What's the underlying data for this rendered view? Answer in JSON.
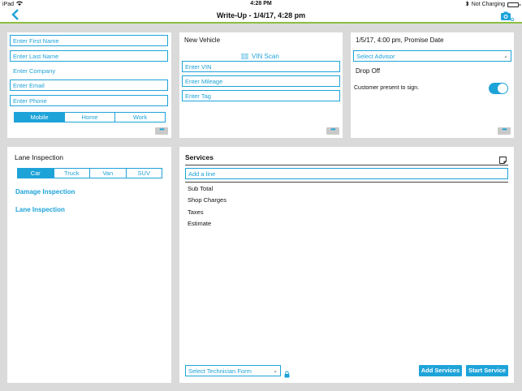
{
  "status_bar": {
    "device": "iPad",
    "time": "4:28 PM",
    "charging": "Not Charging"
  },
  "nav": {
    "title": "Write-Up - 1/4/17, 4:28 pm"
  },
  "customer": {
    "first_name_placeholder": "Enter First Name",
    "last_name_placeholder": "Enter Last Name",
    "company_placeholder": "Enter Company",
    "email_placeholder": "Enter Email",
    "phone_placeholder": "Enter Phone",
    "phone_types": [
      "Mobile",
      "Home",
      "Work"
    ],
    "phone_type_selected": "Mobile",
    "more": "•••"
  },
  "vehicle": {
    "title": "New Vehicle",
    "vin_scan": "VIN Scan",
    "vin_placeholder": "Enter VIN",
    "mileage_placeholder": "Enter Mileage",
    "tag_placeholder": "Enter Tag",
    "more": "•••"
  },
  "promise": {
    "date_label": "1/5/17, 4:00 pm, Promise Date",
    "advisor_placeholder": "Select Advisor",
    "drop_off": "Drop Off",
    "customer_present": "Customer present to sign.",
    "customer_present_on": true,
    "more": "•••"
  },
  "lane": {
    "title": "Lane Inspection",
    "types": [
      "Car",
      "Truck",
      "Van",
      "SUV"
    ],
    "type_selected": "Car",
    "damage_link": "Damage Inspection",
    "lane_link": "Lane Inspection"
  },
  "services": {
    "title": "Services",
    "add_line_placeholder": "Add a line",
    "totals": [
      "Sub Total",
      "Shop Charges",
      "Taxes",
      "Estimate"
    ],
    "technician_placeholder": "Select Technician Form",
    "add_services": "Add Services",
    "start_service": "Start Service"
  },
  "colors": {
    "accent": "#1ea3d9",
    "nav_border": "#8cbf3f",
    "background": "#dadada"
  }
}
